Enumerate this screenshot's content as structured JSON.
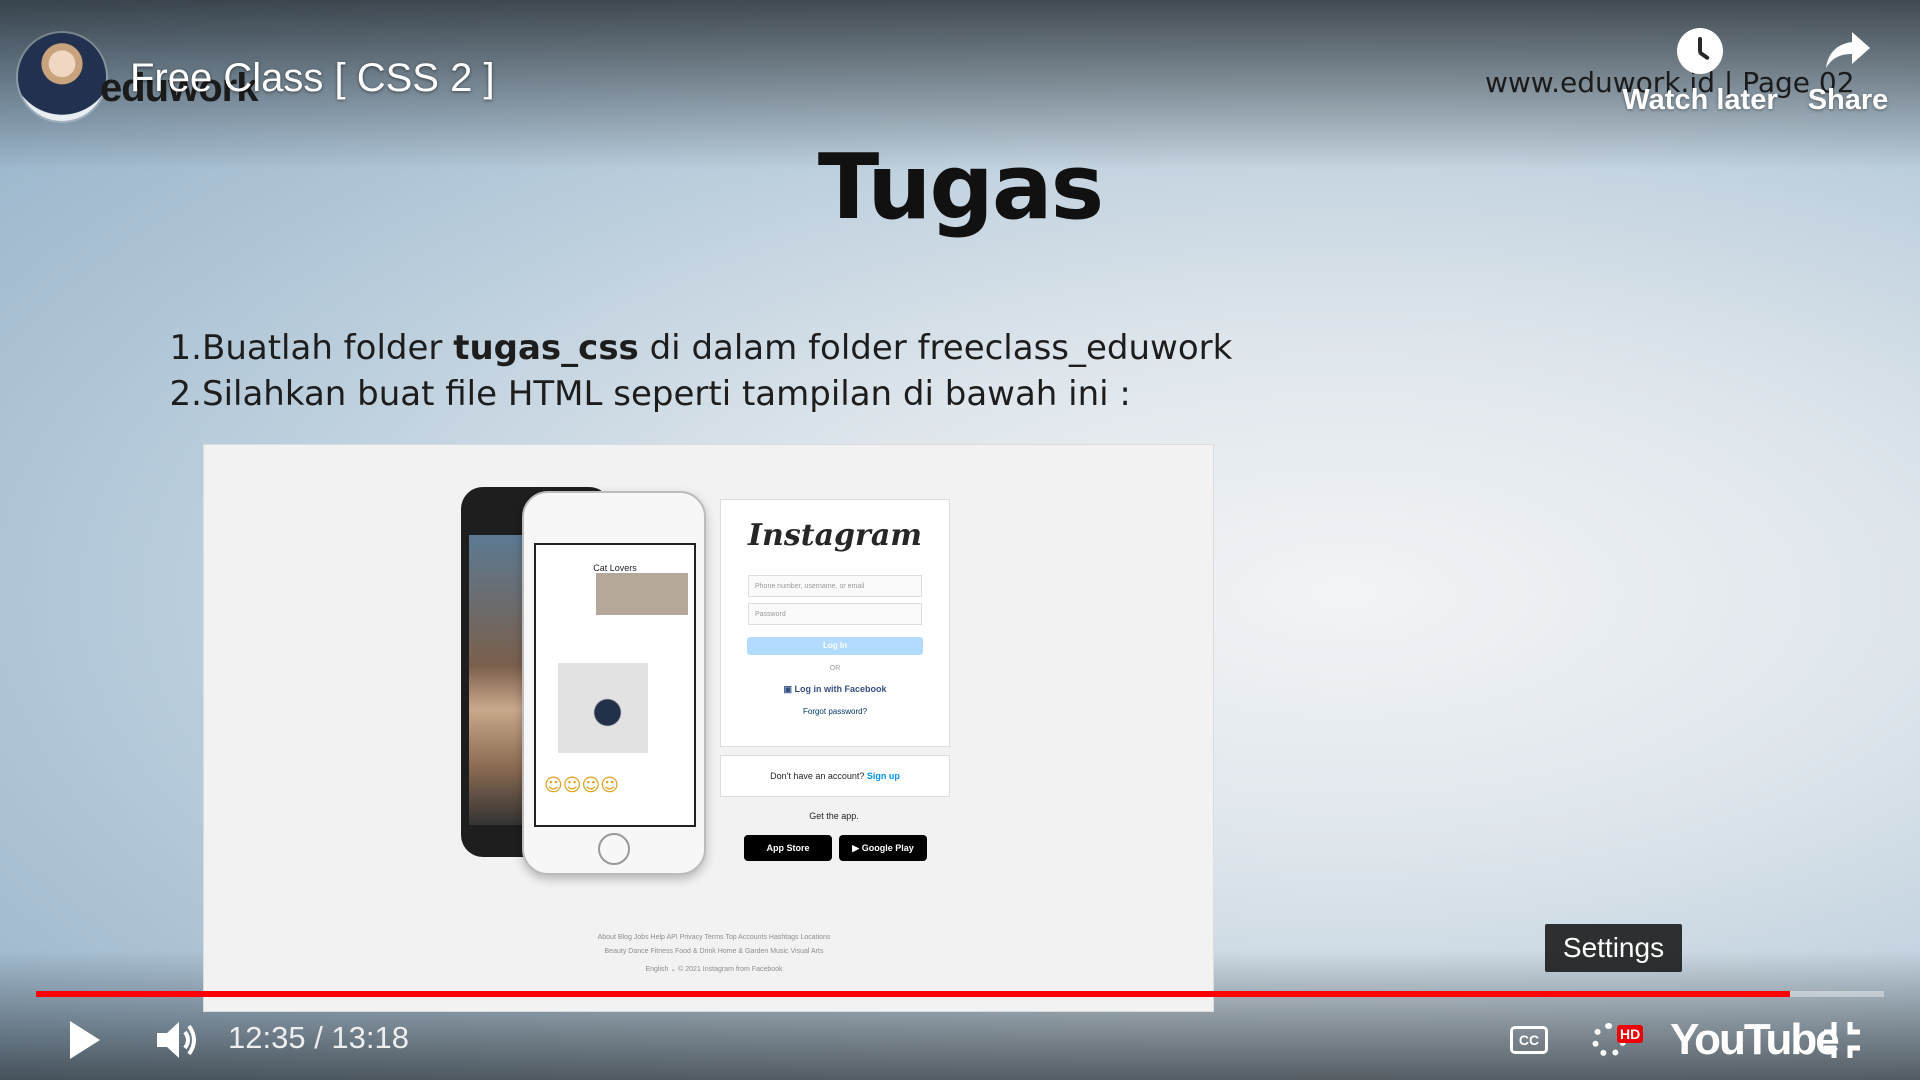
{
  "header": {
    "video_title": "Free Class [ CSS 2 ]",
    "channel_logo": "eduwork",
    "site_page": "www.eduwork.id | Page 02",
    "watch_later_label": "Watch later",
    "share_label": "Share"
  },
  "slide": {
    "title": "Tugas",
    "tasks": [
      {
        "num": "1.",
        "pre": "Buatlah folder ",
        "bold": "tugas_css",
        "post": " di dalam folder freeclass_eduwork"
      },
      {
        "num": "2.",
        "pre": "Silahkan buat file HTML seperti tampilan di bawah ini :",
        "bold": "",
        "post": ""
      }
    ],
    "preview": {
      "logo": "Instagram",
      "phone_header": "Cat Lovers",
      "username_placeholder": "Phone number, username, or email",
      "password_placeholder": "Password",
      "login_button": "Log In",
      "or_text": "OR",
      "facebook_login": "Log in with Facebook",
      "forgot_password": "Forgot password?",
      "no_account": "Don't have an account?",
      "signup_link": "Sign up",
      "get_app": "Get the app.",
      "app_store": "App Store",
      "google_play": "Google Play",
      "footer_line1": "About   Blog   Jobs   Help   API   Privacy   Terms   Top Accounts   Hashtags   Locations",
      "footer_line2": "Beauty   Dance   Fitness   Food & Drink   Home & Garden   Music   Visual Arts",
      "footer_line3": "English ⌄    © 2021 Instagram from Facebook"
    }
  },
  "player": {
    "time_display": "12:35 / 13:18",
    "progress_fraction": 0.949,
    "settings_tooltip": "Settings",
    "hd_badge": "HD",
    "cc_label": "CC",
    "brand": "YouTube",
    "accent_color": "#ff0000"
  }
}
